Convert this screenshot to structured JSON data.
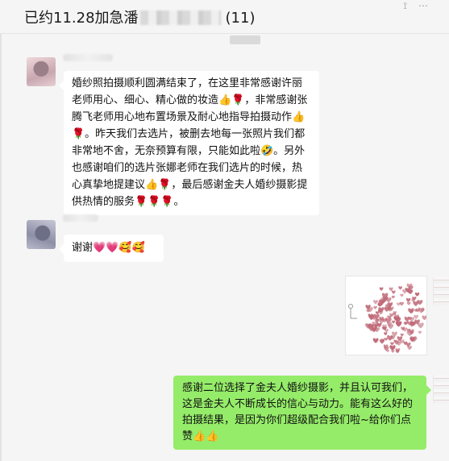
{
  "chat": {
    "title_prefix": "已约11.28加急潘",
    "title_count": "(11)",
    "timestamp": "",
    "header_icons": [
      "pin-icon",
      "more-icon"
    ]
  },
  "messages": [
    {
      "side": "left",
      "text": "婚纱照拍摄顺利圆满结束了，在这里非常感谢许丽老师用心、细心、精心做的妆造👍🌹，非常感谢张腾飞老师用心地布置场景及耐心地指导拍摄动作👍🌹。昨天我们去选片，被删去地每一张照片我们都非常地不舍，无奈预算有限，只能如此啦🤣。另外也感谢咱们的选片张娜老师在我们选片的时候，热心真挚地提建议👍🌹，最后感谢金夫人婚纱摄影提供热情的服务🌹🌹🌹。"
    },
    {
      "side": "left",
      "text": "谢谢💗💗🥰🥰"
    },
    {
      "side": "right",
      "type": "image",
      "description_icon": "hearts-image"
    },
    {
      "side": "right",
      "text": "感谢二位选择了金夫人婚纱摄影，并且认可我们，这是金夫人不断成长的信心与动力。能有这么好的拍摄结果，是因为你们超级配合我们啦~给你们点赞👍👍"
    }
  ],
  "colors": {
    "background": "#f5f5f5",
    "incoming_bubble": "#ffffff",
    "outgoing_bubble": "#95ec69",
    "heart": "#c06a78"
  }
}
